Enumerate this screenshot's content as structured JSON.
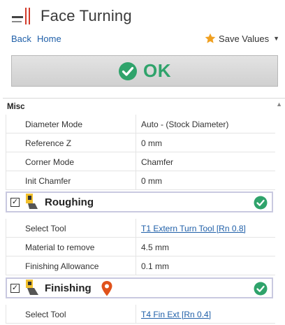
{
  "header": {
    "title": "Face Turning",
    "icon": "face-turning-icon"
  },
  "nav": {
    "back": "Back",
    "home": "Home",
    "save_values": "Save Values"
  },
  "ok_button": {
    "label": "OK",
    "accent": "#2fa36b"
  },
  "misc": {
    "title": "Misc",
    "rows": [
      {
        "label": "Diameter Mode",
        "value": "Auto - (Stock Diameter)"
      },
      {
        "label": "Reference Z",
        "value": "0 mm"
      },
      {
        "label": "Corner Mode",
        "value": "Chamfer"
      },
      {
        "label": "Init Chamfer",
        "value": "0 mm"
      }
    ]
  },
  "roughing": {
    "label": "Roughing",
    "checked": true,
    "rows": [
      {
        "label": "Select Tool",
        "value": "T1 Extern Turn Tool  [Rn 0.8]"
      },
      {
        "label": "Material to remove",
        "value": "4.5 mm"
      },
      {
        "label": "Finishing Allowance",
        "value": "0.1 mm"
      }
    ]
  },
  "finishing": {
    "label": "Finishing",
    "checked": true,
    "rows": [
      {
        "label": "Select Tool",
        "value": "T4 Fin Ext  [Rn 0.4]"
      }
    ]
  },
  "colors": {
    "link": "#1f5fa8",
    "ok_green": "#2fa36b",
    "pin_red": "#e0521b",
    "group_border": "#c9c9e0"
  }
}
